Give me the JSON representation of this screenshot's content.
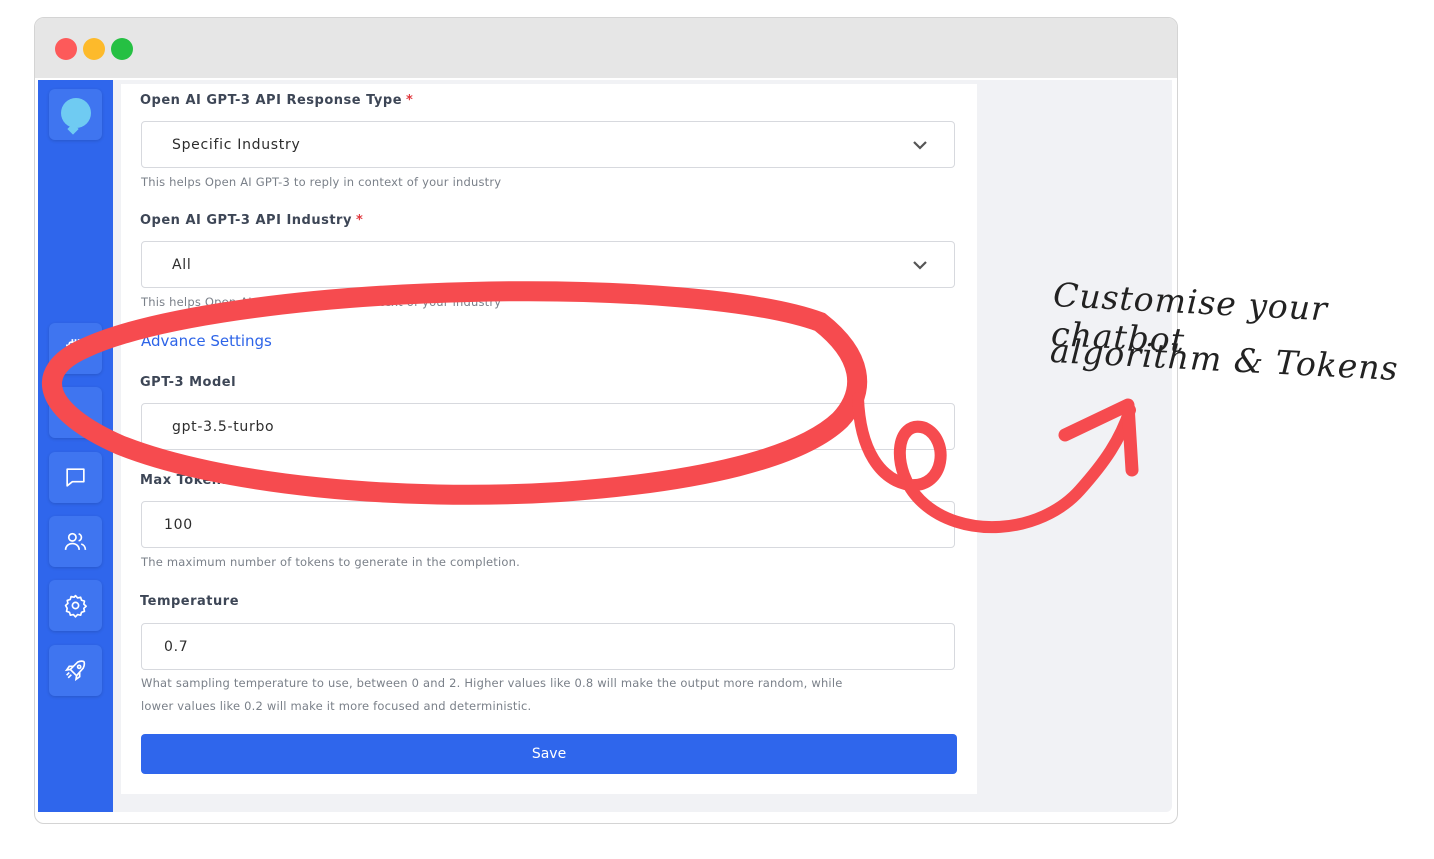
{
  "fields": {
    "response_type": {
      "label": "Open AI GPT-3 API Response Type",
      "required_mark": "*",
      "value": "Specific Industry",
      "help": "This helps Open AI GPT-3 to reply in context of your industry"
    },
    "industry": {
      "label": "Open AI GPT-3 API Industry",
      "required_mark": "*",
      "value": "All",
      "help": "This helps Open AI GPT-3 to reply in context of your industry"
    },
    "advance_settings_link": "Advance Settings",
    "model": {
      "label": "GPT-3 Model",
      "value": "gpt-3.5-turbo"
    },
    "max_tokens": {
      "label": "Max Tokens",
      "value": "100",
      "help": "The maximum number of tokens to generate in the completion."
    },
    "temperature": {
      "label": "Temperature",
      "value": "0.7",
      "help_line1": "What sampling temperature to use, between 0 and 2. Higher values like 0.8 will make the output more random, while",
      "help_line2": "lower values like 0.2 will make it more focused and deterministic."
    }
  },
  "save_label": "Save",
  "annotation": {
    "line1": "Customise your chatbot",
    "line2": "algorithm & Tokens",
    "color": "#f64b4f"
  },
  "sidebar_icons": [
    "chat-bubble-logo-icon",
    "chip-icon",
    "message-icon",
    "users-icon",
    "gear-icon",
    "rocket-icon"
  ],
  "colors": {
    "accent": "#2f66ec",
    "required": "#e0383e",
    "titlebar": "#e6e6e6"
  }
}
